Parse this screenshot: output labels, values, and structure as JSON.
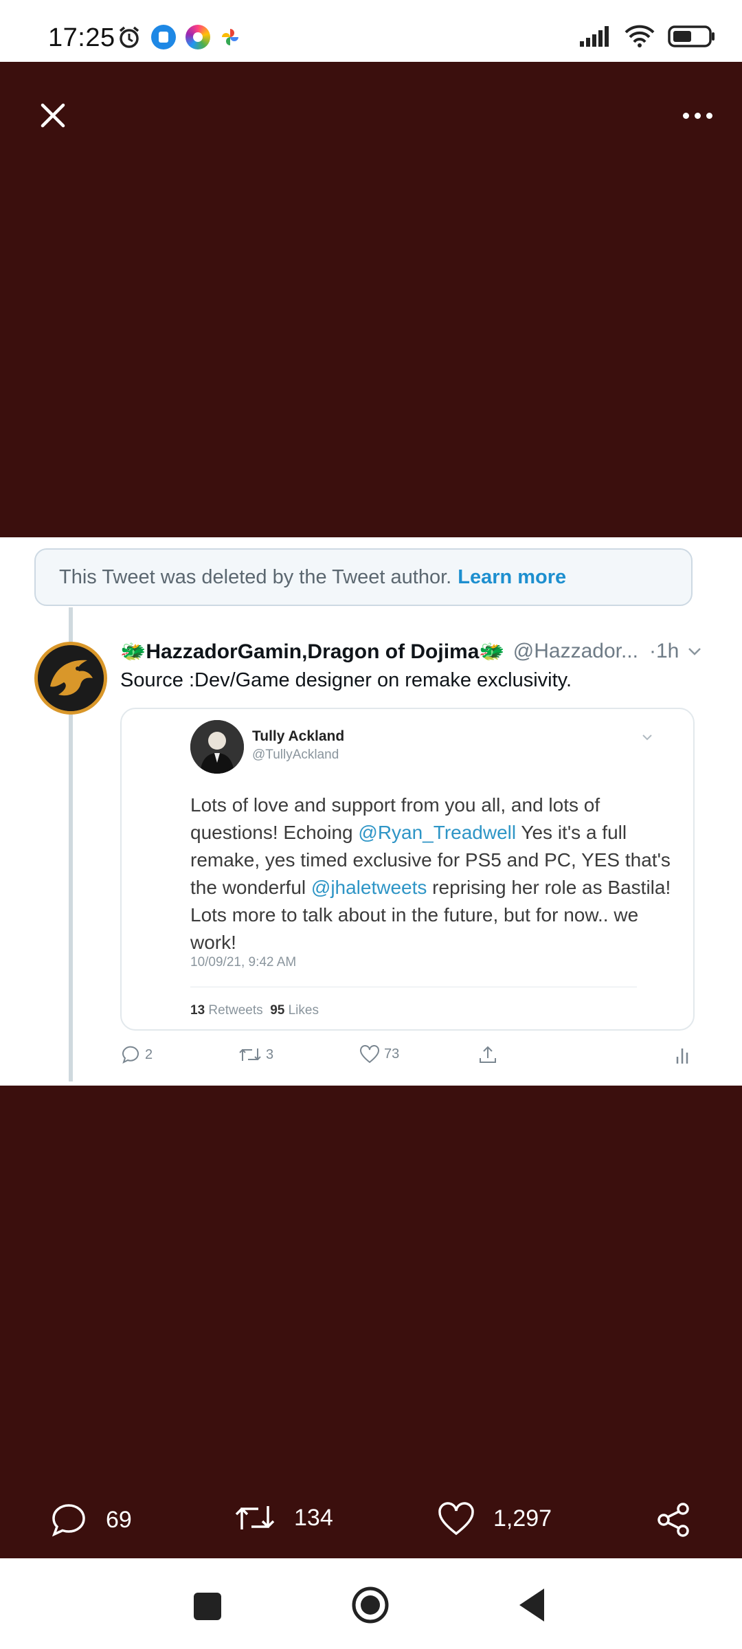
{
  "status_bar": {
    "time": "17:25"
  },
  "viewer": {
    "close_icon": "close-icon",
    "more_icon": "more-icon"
  },
  "tweet_image": {
    "deleted_notice": "This Tweet was deleted by the Tweet author.",
    "learn_more": "Learn more",
    "author_name": "🐲HazzadorGamin,Dragon of Dojima🐲",
    "author_handle": "@Hazzador...",
    "time": "·1h",
    "text": "Source :Dev/Game designer on remake exclusivity.",
    "quote": {
      "name": "Tully Ackland",
      "handle": "@TullyAckland",
      "body_1": "Lots of love and support from you all, and lots of questions! Echoing ",
      "mention_1": "@Ryan_Treadwell",
      "body_2": " Yes it's a full remake, yes timed exclusive for PS5 and PC, YES that's the wonderful ",
      "mention_2": "@jhaletweets",
      "body_3": " reprising her role as Bastila! Lots more to talk about in the future, but for now.. we work!",
      "date": "10/09/21, 9:42 AM",
      "retweets_count": "13",
      "retweets_label": "Retweets",
      "likes_count": "95",
      "likes_label": "Likes"
    },
    "inner_actions": {
      "replies": "2",
      "retweets": "3",
      "likes": "73"
    }
  },
  "action_bar": {
    "replies": "69",
    "retweets": "134",
    "likes": "1,297"
  },
  "colors": {
    "viewer_background": "#3b0f0d",
    "link": "#1d8fcf",
    "avatar_ring": "#d9972a"
  }
}
